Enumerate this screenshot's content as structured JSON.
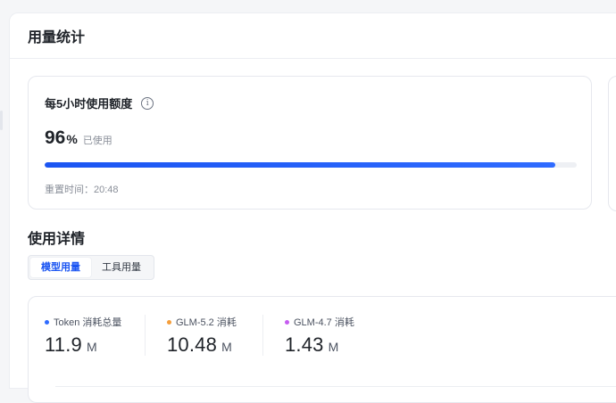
{
  "panel": {
    "title": "用量统计"
  },
  "quota": {
    "title": "每5小时使用额度",
    "info_icon": "info-icon",
    "percent": "96",
    "percent_sign": "%",
    "percent_note": "已使用",
    "progress_fraction": 0.96,
    "reset_label": "重置时间：",
    "reset_time": "20:48"
  },
  "details": {
    "title": "使用详情",
    "tabs": [
      {
        "label": "模型用量",
        "active": true
      },
      {
        "label": "工具用量",
        "active": false
      }
    ]
  },
  "stats": [
    {
      "label": "Token 消耗总量",
      "value": "11.9",
      "unit": "M",
      "dot_color": "#2f6bff"
    },
    {
      "label": "GLM-5.2 消耗",
      "value": "10.48",
      "unit": "M",
      "dot_color": "#f59e3b"
    },
    {
      "label": "GLM-4.7 消耗",
      "value": "1.43",
      "unit": "M",
      "dot_color": "#c65cf0"
    }
  ],
  "colors": {
    "accent": "#1b55f2",
    "progress": "#2f6bff"
  }
}
